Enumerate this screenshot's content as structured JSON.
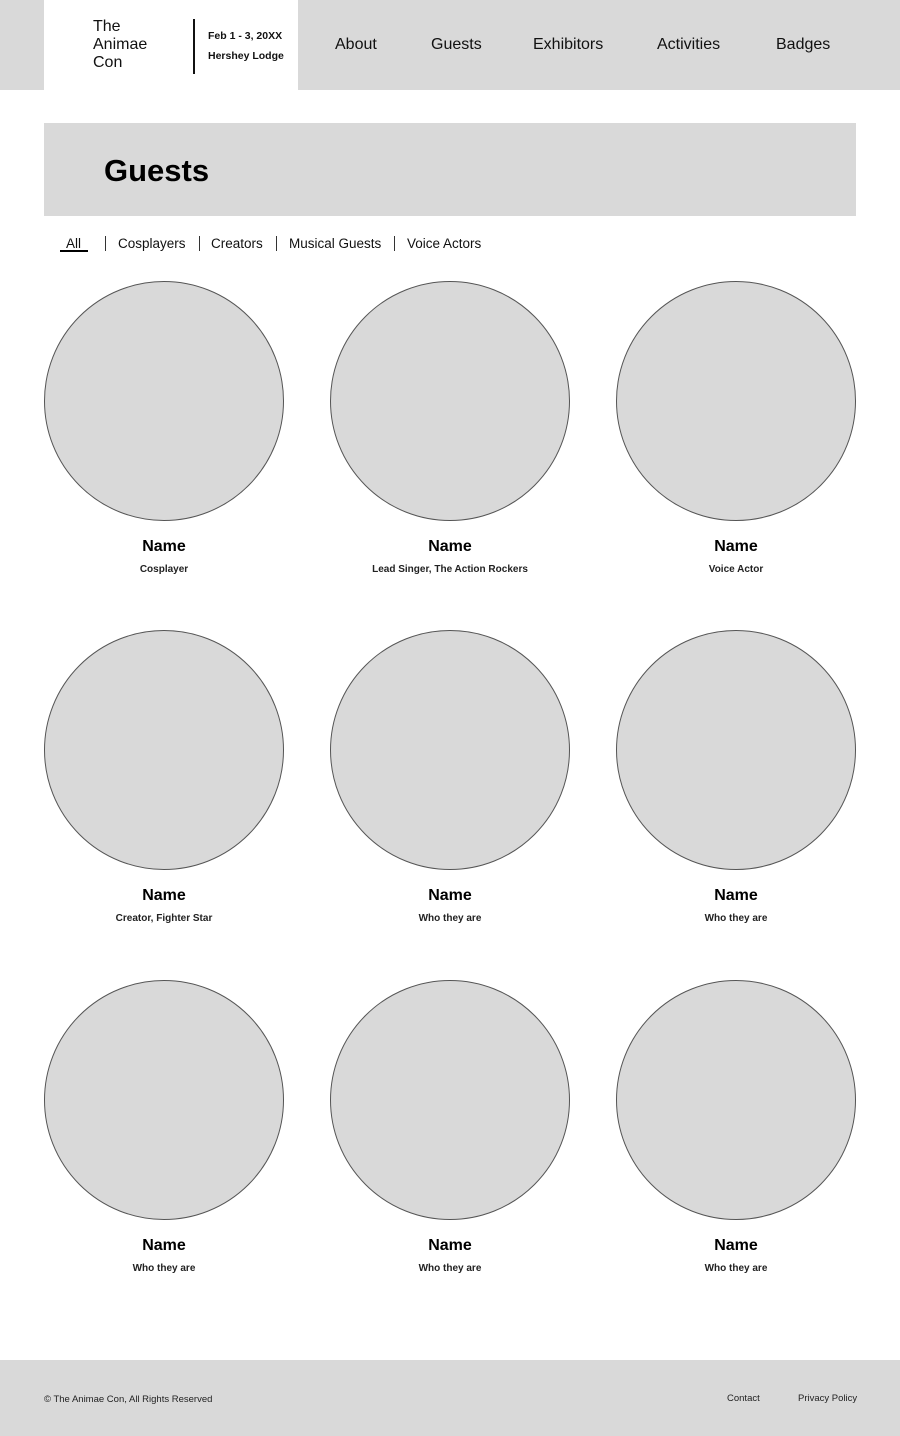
{
  "header": {
    "logo_title": "The Animae Con",
    "event_date": "Feb 1 - 3, 20XX",
    "event_venue": "Hershey Lodge",
    "nav": [
      {
        "label": "About"
      },
      {
        "label": "Guests"
      },
      {
        "label": "Exhibitors"
      },
      {
        "label": "Activities"
      },
      {
        "label": "Badges"
      }
    ]
  },
  "banner": {
    "title": "Guests"
  },
  "filters": {
    "active": "All",
    "items": [
      {
        "label": "All"
      },
      {
        "label": "Cosplayers"
      },
      {
        "label": "Creators"
      },
      {
        "label": "Musical Guests"
      },
      {
        "label": "Voice Actors"
      }
    ]
  },
  "guests": [
    {
      "name": "Name",
      "role": "Cosplayer"
    },
    {
      "name": "Name",
      "role": "Lead Singer, The Action Rockers"
    },
    {
      "name": "Name",
      "role": "Voice Actor"
    },
    {
      "name": "Name",
      "role": "Creator, Fighter Star"
    },
    {
      "name": "Name",
      "role": "Who they are"
    },
    {
      "name": "Name",
      "role": "Who they are"
    },
    {
      "name": "Name",
      "role": "Who they are"
    },
    {
      "name": "Name",
      "role": "Who they are"
    },
    {
      "name": "Name",
      "role": "Who they are"
    }
  ],
  "footer": {
    "copyright": "© The Animae Con, All Rights Reserved",
    "links": [
      {
        "label": "Contact"
      },
      {
        "label": "Privacy Policy"
      }
    ]
  },
  "colors": {
    "panel_gray": "#d9d9d9",
    "text": "#000000",
    "circle_border": "#555555"
  }
}
